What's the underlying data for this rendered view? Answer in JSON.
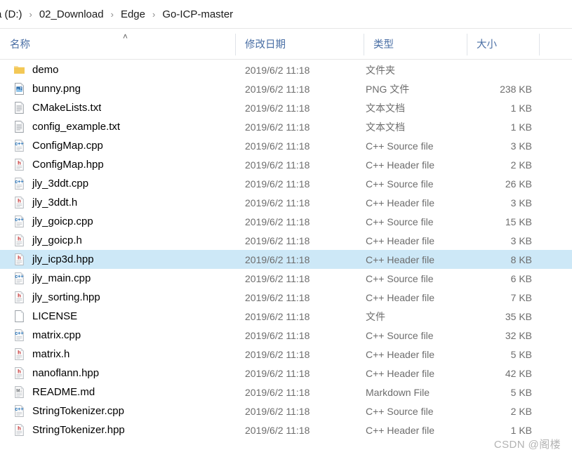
{
  "breadcrumb": {
    "segments": [
      "a (D:)",
      "02_Download",
      "Edge",
      "Go-ICP-master"
    ],
    "separator": "›"
  },
  "columns": {
    "name": "名称",
    "date_modified": "修改日期",
    "type": "类型",
    "size": "大小",
    "sort_indicator": "˄",
    "sort_column": "name",
    "sort_direction": "ascending"
  },
  "colors": {
    "header_text": "#4a6fa5",
    "selection": "#cde8f7",
    "cpp_icon": "#2b6cb0",
    "header_icon": "#c0392b",
    "folder": "#f2c14e",
    "secondary_text": "#6d6d6d"
  },
  "files": [
    {
      "name": "demo",
      "date": "2019/6/2 11:18",
      "type": "文件夹",
      "size": "",
      "icon": "folder-icon",
      "selected": false
    },
    {
      "name": "bunny.png",
      "date": "2019/6/2 11:18",
      "type": "PNG 文件",
      "size": "238 KB",
      "icon": "image-icon",
      "selected": false
    },
    {
      "name": "CMakeLists.txt",
      "date": "2019/6/2 11:18",
      "type": "文本文档",
      "size": "1 KB",
      "icon": "text-icon",
      "selected": false
    },
    {
      "name": "config_example.txt",
      "date": "2019/6/2 11:18",
      "type": "文本文档",
      "size": "1 KB",
      "icon": "text-icon",
      "selected": false
    },
    {
      "name": "ConfigMap.cpp",
      "date": "2019/6/2 11:18",
      "type": "C++ Source file",
      "size": "3 KB",
      "icon": "cpp-source-icon",
      "selected": false
    },
    {
      "name": "ConfigMap.hpp",
      "date": "2019/6/2 11:18",
      "type": "C++ Header file",
      "size": "2 KB",
      "icon": "cpp-header-icon",
      "selected": false
    },
    {
      "name": "jly_3ddt.cpp",
      "date": "2019/6/2 11:18",
      "type": "C++ Source file",
      "size": "26 KB",
      "icon": "cpp-source-icon",
      "selected": false
    },
    {
      "name": "jly_3ddt.h",
      "date": "2019/6/2 11:18",
      "type": "C++ Header file",
      "size": "3 KB",
      "icon": "cpp-header-icon",
      "selected": false
    },
    {
      "name": "jly_goicp.cpp",
      "date": "2019/6/2 11:18",
      "type": "C++ Source file",
      "size": "15 KB",
      "icon": "cpp-source-icon",
      "selected": false
    },
    {
      "name": "jly_goicp.h",
      "date": "2019/6/2 11:18",
      "type": "C++ Header file",
      "size": "3 KB",
      "icon": "cpp-header-icon",
      "selected": false
    },
    {
      "name": "jly_icp3d.hpp",
      "date": "2019/6/2 11:18",
      "type": "C++ Header file",
      "size": "8 KB",
      "icon": "cpp-header-icon",
      "selected": true
    },
    {
      "name": "jly_main.cpp",
      "date": "2019/6/2 11:18",
      "type": "C++ Source file",
      "size": "6 KB",
      "icon": "cpp-source-icon",
      "selected": false
    },
    {
      "name": "jly_sorting.hpp",
      "date": "2019/6/2 11:18",
      "type": "C++ Header file",
      "size": "7 KB",
      "icon": "cpp-header-icon",
      "selected": false
    },
    {
      "name": "LICENSE",
      "date": "2019/6/2 11:18",
      "type": "文件",
      "size": "35 KB",
      "icon": "blank-file-icon",
      "selected": false
    },
    {
      "name": "matrix.cpp",
      "date": "2019/6/2 11:18",
      "type": "C++ Source file",
      "size": "32 KB",
      "icon": "cpp-source-icon",
      "selected": false
    },
    {
      "name": "matrix.h",
      "date": "2019/6/2 11:18",
      "type": "C++ Header file",
      "size": "5 KB",
      "icon": "cpp-header-icon",
      "selected": false
    },
    {
      "name": "nanoflann.hpp",
      "date": "2019/6/2 11:18",
      "type": "C++ Header file",
      "size": "42 KB",
      "icon": "cpp-header-icon",
      "selected": false
    },
    {
      "name": "README.md",
      "date": "2019/6/2 11:18",
      "type": "Markdown File",
      "size": "5 KB",
      "icon": "markdown-icon",
      "selected": false
    },
    {
      "name": "StringTokenizer.cpp",
      "date": "2019/6/2 11:18",
      "type": "C++ Source file",
      "size": "2 KB",
      "icon": "cpp-source-icon",
      "selected": false
    },
    {
      "name": "StringTokenizer.hpp",
      "date": "2019/6/2 11:18",
      "type": "C++ Header file",
      "size": "1 KB",
      "icon": "cpp-header-icon",
      "selected": false
    }
  ],
  "watermark": "CSDN @阁楼"
}
